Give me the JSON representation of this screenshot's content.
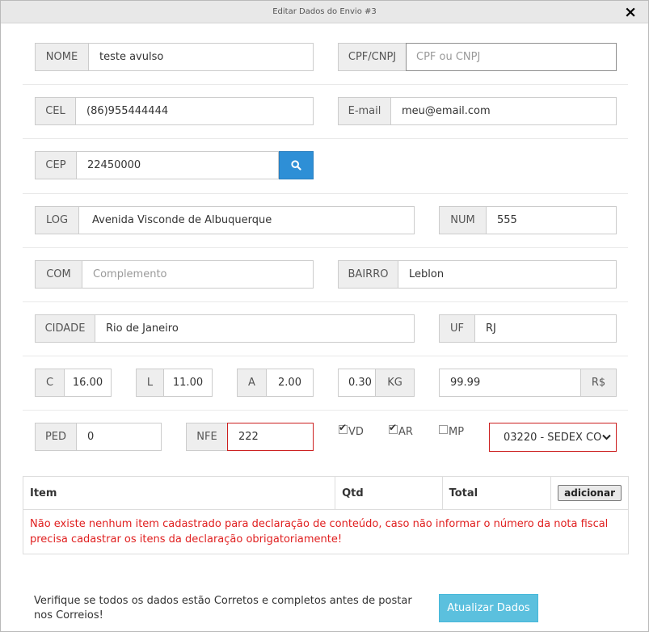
{
  "modal": {
    "title": "Editar Dados do Envio #3",
    "close_icon": "×"
  },
  "form": {
    "nome": {
      "label": "NOME",
      "value": "teste avulso"
    },
    "cpf": {
      "label": "CPF/CNPJ",
      "placeholder": "CPF ou CNPJ"
    },
    "cel": {
      "label": "CEL",
      "value": "(86)955444444"
    },
    "email": {
      "label": "E-mail",
      "value": "meu@email.com"
    },
    "cep": {
      "label": "CEP",
      "value": "22450000",
      "search_icon": "search-icon"
    },
    "log": {
      "label": "LOG",
      "value": "Avenida Visconde de Albuquerque"
    },
    "num": {
      "label": "NUM",
      "value": "555"
    },
    "com": {
      "label": "COM",
      "placeholder": "Complemento"
    },
    "bairro": {
      "label": "BAIRRO",
      "value": "Leblon"
    },
    "cidade": {
      "label": "CIDADE",
      "value": "Rio de Janeiro"
    },
    "uf": {
      "label": "UF",
      "value": "RJ"
    },
    "c": {
      "label": "C",
      "value": "16.00"
    },
    "l": {
      "label": "L",
      "value": "11.00"
    },
    "a": {
      "label": "A",
      "value": "2.00"
    },
    "peso": {
      "value": "0.30",
      "unit": "KG"
    },
    "valor": {
      "value": "99.99",
      "unit": "R$"
    },
    "ped": {
      "label": "PED",
      "value": "0"
    },
    "nfe": {
      "label": "NFE",
      "value": "222"
    },
    "options": {
      "vd": {
        "label": "VD",
        "checked": true
      },
      "ar": {
        "label": "AR",
        "checked": true
      },
      "mp": {
        "label": "MP",
        "checked": false
      }
    },
    "servico": {
      "selected": "03220 - SEDEX CO"
    }
  },
  "items_table": {
    "headers": {
      "item": "Item",
      "qtd": "Qtd",
      "total": "Total"
    },
    "add_button": "adicionar",
    "empty_message": "Não existe nenhum item cadastrado para declaração de conteúdo, caso não informar o número da nota fiscal precisa cadastrar os itens da declaração obrigatoriamente!"
  },
  "footer": {
    "notice": "Verifique se todos os dados estão Corretos e completos antes de postar nos Correios!",
    "update_button": "Atualizar Dados"
  },
  "colors": {
    "primary": "#2e8fd6",
    "info": "#5bc0de",
    "error": "#cc1f1f"
  }
}
